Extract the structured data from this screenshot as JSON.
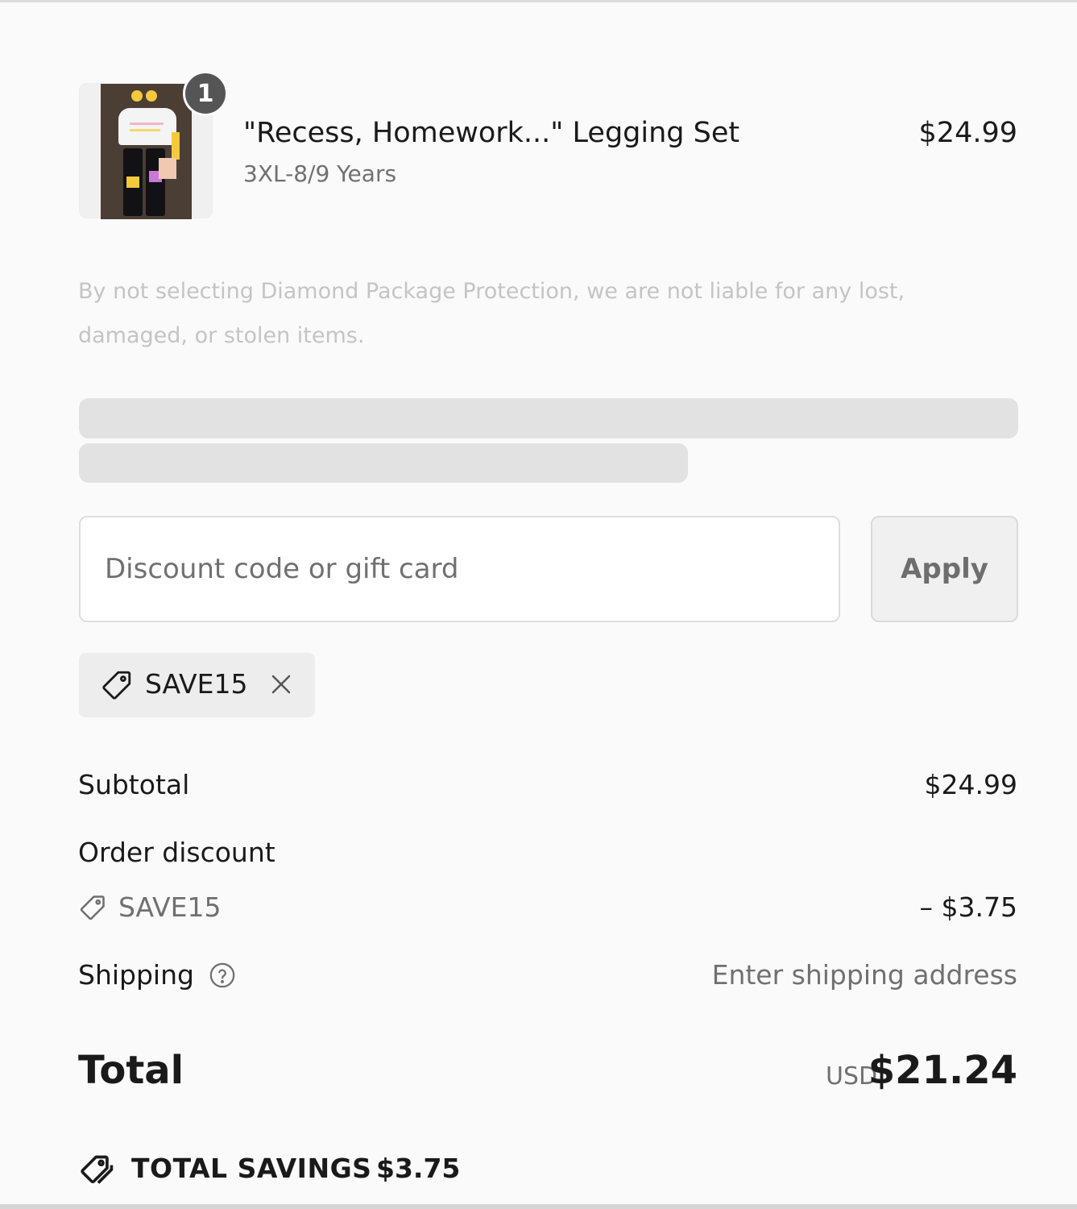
{
  "product": {
    "quantity": "1",
    "title": "\"Recess, Homework...\" Legging Set",
    "variant": "3XL-8/9 Years",
    "price": "$24.99"
  },
  "notice": "By not selecting Diamond Package Protection, we are not liable for any lost, damaged, or stolen items.",
  "discount": {
    "placeholder": "Discount code or gift card",
    "value": "",
    "apply_label": "Apply",
    "applied_code": "SAVE15"
  },
  "summary": {
    "subtotal_label": "Subtotal",
    "subtotal_value": "$24.99",
    "order_discount_label": "Order discount",
    "discount_code": "SAVE15",
    "discount_value": "– $3.75",
    "shipping_label": "Shipping",
    "shipping_value": "Enter shipping address",
    "total_label": "Total",
    "total_currency": "USD",
    "total_value": "$21.24",
    "savings_label": "TOTAL SAVINGS",
    "savings_value": "$3.75"
  },
  "icons": {
    "tag": "tag-icon",
    "remove": "close-icon",
    "help": "question-circle-icon",
    "savings": "tags-icon"
  }
}
